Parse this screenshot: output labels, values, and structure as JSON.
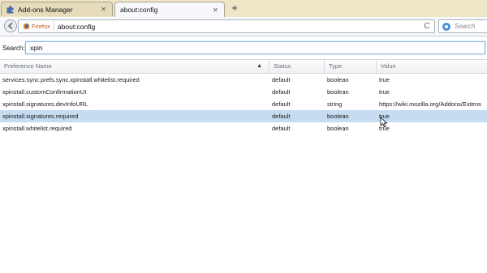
{
  "tabs": [
    {
      "label": "Add-ons Manager",
      "icon": "puzzle-piece-icon",
      "active": false
    },
    {
      "label": "about:config",
      "icon": "",
      "active": true
    }
  ],
  "new_tab_label": "+",
  "navbar": {
    "identity_label": "Firefox",
    "url": "about:config",
    "reload_glyph": "C",
    "search_placeholder": "Search"
  },
  "config": {
    "search_label": "Search:",
    "search_value": "xpin",
    "columns": {
      "name": "Preference Name",
      "status": "Status",
      "type": "Type",
      "value": "Value"
    },
    "rows": [
      {
        "name": "services.sync.prefs.sync.xpinstall.whitelist.required",
        "status": "default",
        "type": "boolean",
        "value": "true"
      },
      {
        "name": "xpinstall.customConfirmationUI",
        "status": "default",
        "type": "boolean",
        "value": "true"
      },
      {
        "name": "xpinstall.signatures.devInfoURL",
        "status": "default",
        "type": "string",
        "value": "https://wiki.mozilla.org/Addons/Extens"
      },
      {
        "name": "xpinstall.signatures.required",
        "status": "default",
        "type": "boolean",
        "value": "true",
        "selected": true
      },
      {
        "name": "xpinstall.whitelist.required",
        "status": "default",
        "type": "boolean",
        "value": "true"
      }
    ]
  },
  "colors": {
    "tabstrip_bg": "#efe6c6",
    "selected_row": "#c5dcf1",
    "firefox_identity": "#b15d1f"
  }
}
